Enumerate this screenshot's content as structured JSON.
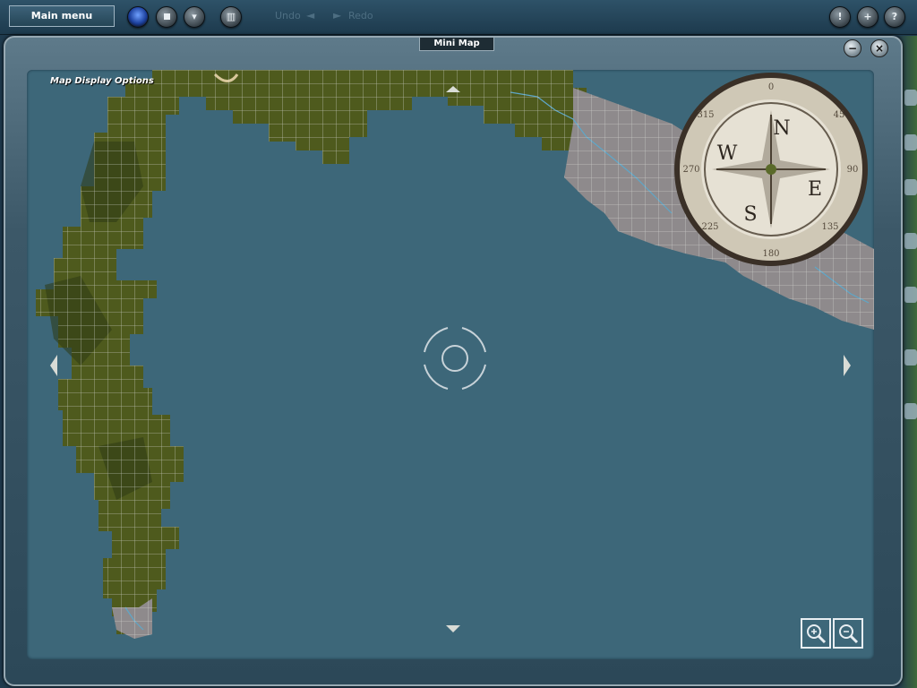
{
  "toolbar": {
    "main_menu_label": "Main menu",
    "buttons": [
      {
        "name": "globe-icon"
      },
      {
        "name": "stop-icon"
      },
      {
        "name": "filter-icon"
      },
      {
        "name": "grid-icon"
      }
    ],
    "undo_label": "Undo",
    "redo_label": "Redo",
    "right_buttons": [
      {
        "name": "info-icon",
        "glyph": "!"
      },
      {
        "name": "add-icon",
        "glyph": "+"
      },
      {
        "name": "help-icon",
        "glyph": "?"
      }
    ]
  },
  "window": {
    "title": "Mini Map",
    "minimize_glyph": "−",
    "close_glyph": "×"
  },
  "map": {
    "options_label": "Map Display Options",
    "colors": {
      "water": "#3d6779",
      "terrain_olive": "#4e5a1d",
      "terrain_dark": "#2e3a14",
      "terrain_gray": "#8e8a8c",
      "grid_line": "#d9dcd6",
      "river": "#5ea7c9"
    },
    "compass": {
      "labels": [
        "N",
        "E",
        "S",
        "W"
      ],
      "degree_marks": [
        "0",
        "45",
        "90",
        "135",
        "180",
        "225",
        "270",
        "315"
      ]
    },
    "zoom_in_icon": "zoom-in-icon",
    "zoom_out_icon": "zoom-out-icon"
  }
}
